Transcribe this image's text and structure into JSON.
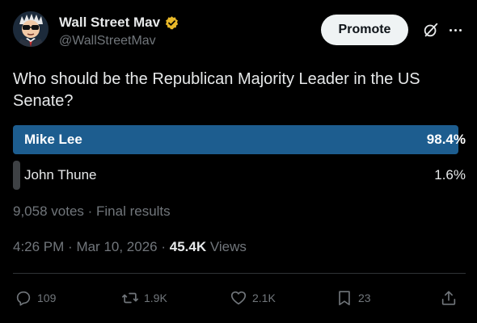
{
  "user": {
    "display_name": "Wall Street Mav",
    "handle": "@WallStreetMav",
    "verified_color": "#e8b829"
  },
  "header": {
    "promote_label": "Promote",
    "icons": [
      "grok-icon",
      "more-icon"
    ]
  },
  "tweet": {
    "text": "Who should be the Republican Majority Leader in the US Senate?"
  },
  "poll": {
    "options": [
      {
        "label": "Mike Lee",
        "percent_text": "98.4%",
        "percent": 98.4
      },
      {
        "label": "John Thune",
        "percent_text": "1.6%",
        "percent": 1.6
      }
    ],
    "meta": "9,058 votes · Final results"
  },
  "post_info": {
    "time": "4:26 PM",
    "date": "Mar 10, 2026",
    "views_count": "45.4K",
    "views_label": "Views"
  },
  "actions": {
    "replies": "109",
    "reposts": "1.9K",
    "likes": "2.1K",
    "bookmarks": "23"
  },
  "colors": {
    "background": "#000000",
    "poll_winner": "#1d5d8f",
    "poll_loser": "#3e4144",
    "muted_text": "#71767b"
  }
}
